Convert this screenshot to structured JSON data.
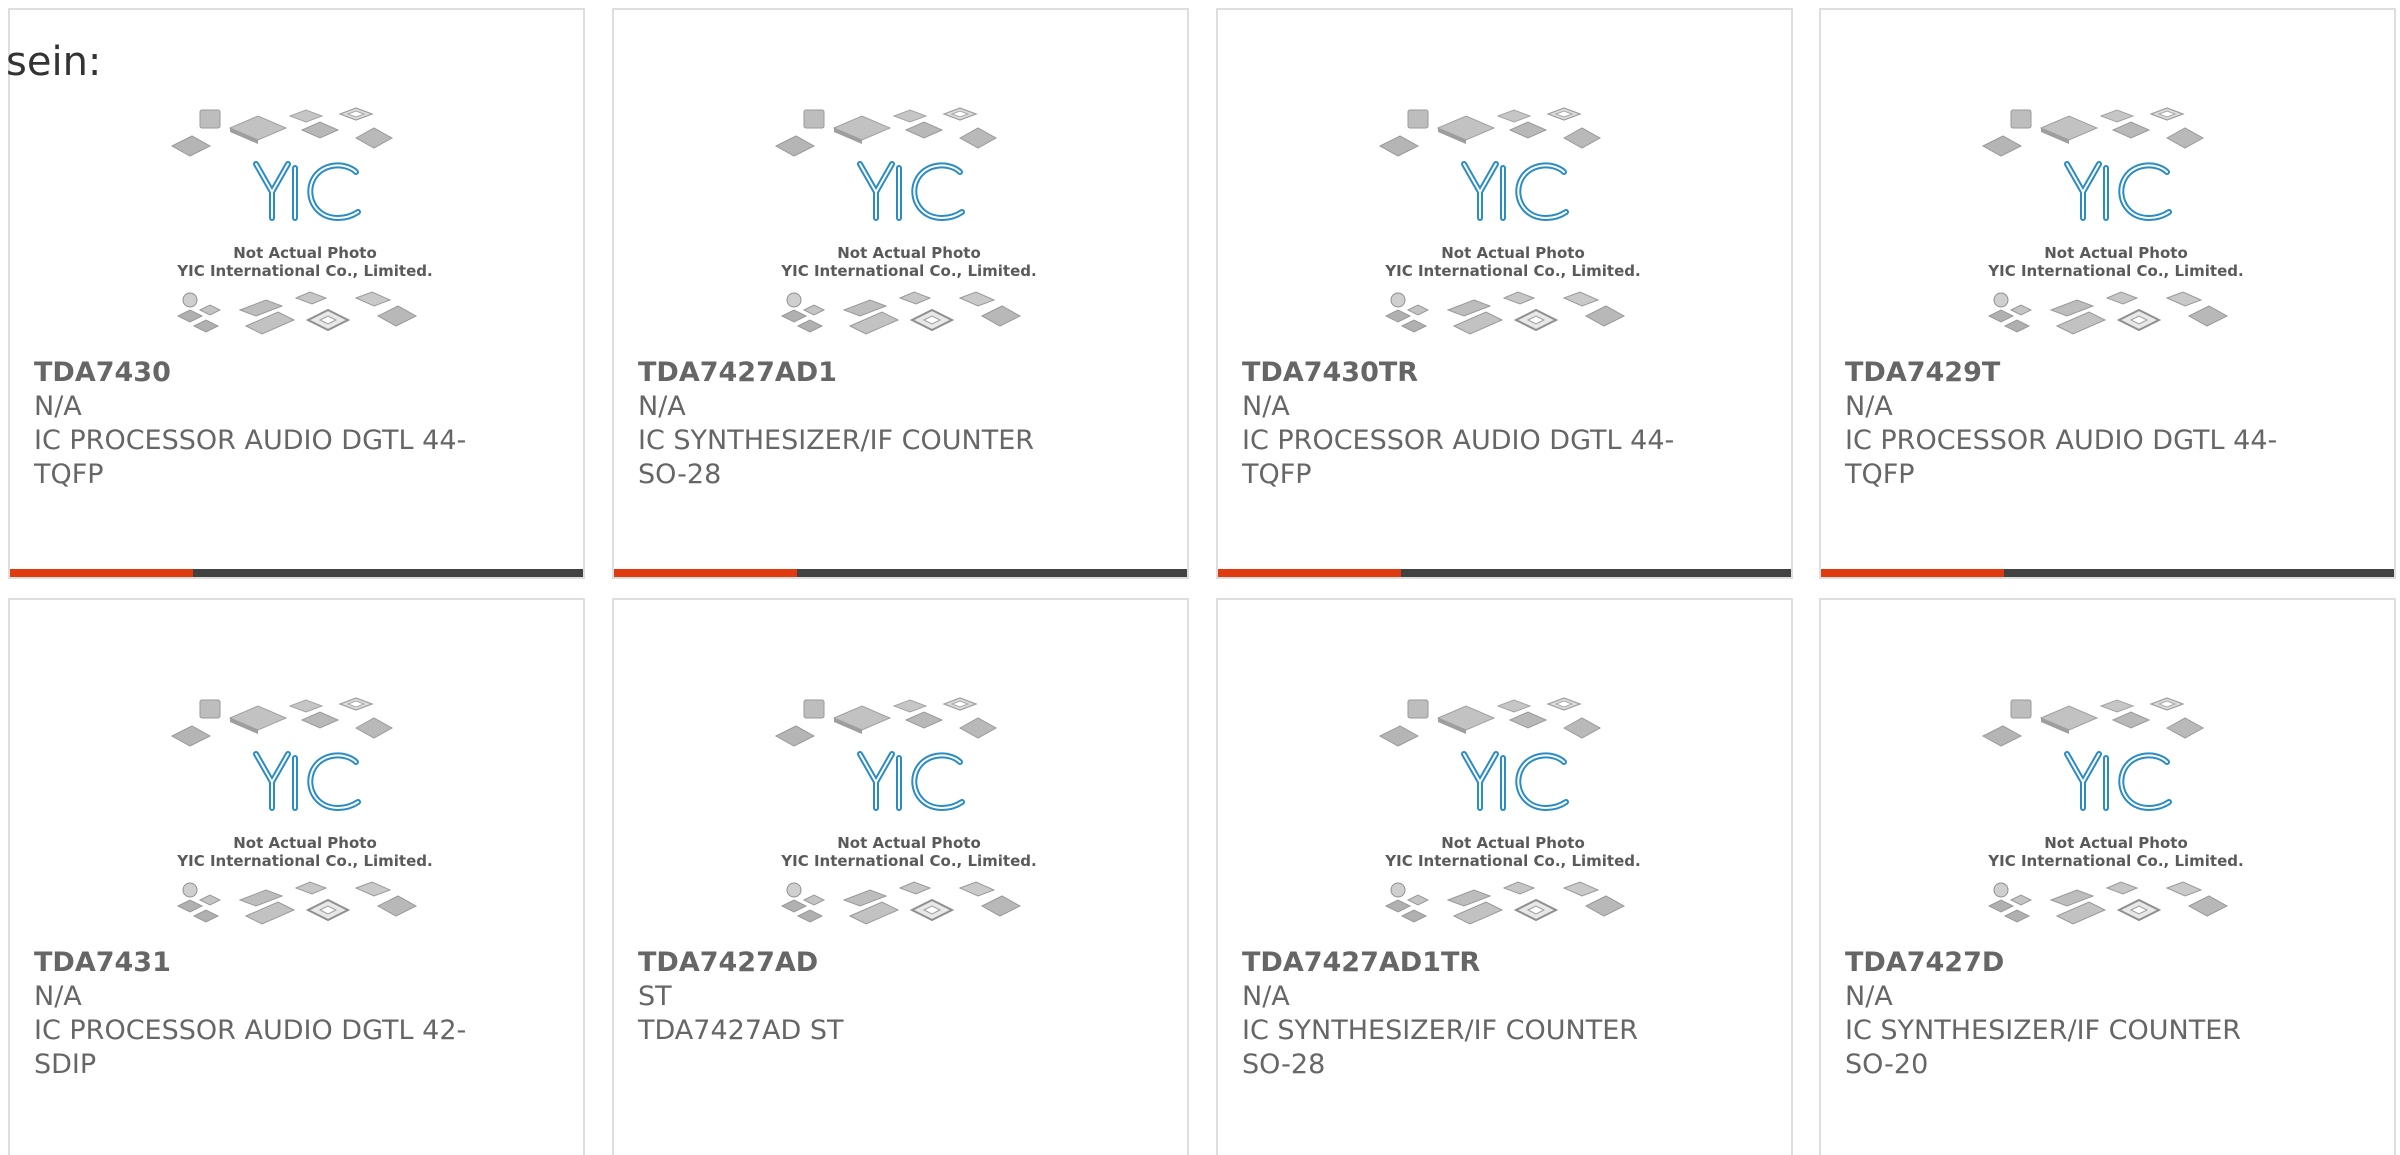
{
  "page": {
    "lead_text": "sein:"
  },
  "photo": {
    "line1": "Not Actual Photo",
    "line2": "YIC International Co., Limited.",
    "logo_text": "YIC"
  },
  "colors": {
    "accent": "#e03a10",
    "bar_dark": "#424242",
    "logo_blue": "#2a8cc4",
    "text_gray": "#666666",
    "card_border": "#dedede"
  },
  "products": [
    {
      "part": "TDA7430",
      "manufacturer": "N/A",
      "desc1": "IC PROCESSOR AUDIO DGTL 44-",
      "desc2": "TQFP"
    },
    {
      "part": "TDA7427AD1",
      "manufacturer": "N/A",
      "desc1": "IC SYNTHESIZER/IF COUNTER",
      "desc2": "SO-28"
    },
    {
      "part": "TDA7430TR",
      "manufacturer": "N/A",
      "desc1": "IC PROCESSOR AUDIO DGTL 44-",
      "desc2": "TQFP"
    },
    {
      "part": "TDA7429T",
      "manufacturer": "N/A",
      "desc1": "IC PROCESSOR AUDIO DGTL 44-",
      "desc2": "TQFP"
    },
    {
      "part": "TDA7431",
      "manufacturer": "N/A",
      "desc1": "IC PROCESSOR AUDIO DGTL 42-",
      "desc2": "SDIP"
    },
    {
      "part": "TDA7427AD",
      "manufacturer": "ST",
      "desc1": "TDA7427AD ST",
      "desc2": ""
    },
    {
      "part": "TDA7427AD1TR",
      "manufacturer": "N/A",
      "desc1": "IC SYNTHESIZER/IF COUNTER",
      "desc2": "SO-28"
    },
    {
      "part": "TDA7427D",
      "manufacturer": "N/A",
      "desc1": "IC SYNTHESIZER/IF COUNTER",
      "desc2": "SO-20"
    }
  ]
}
